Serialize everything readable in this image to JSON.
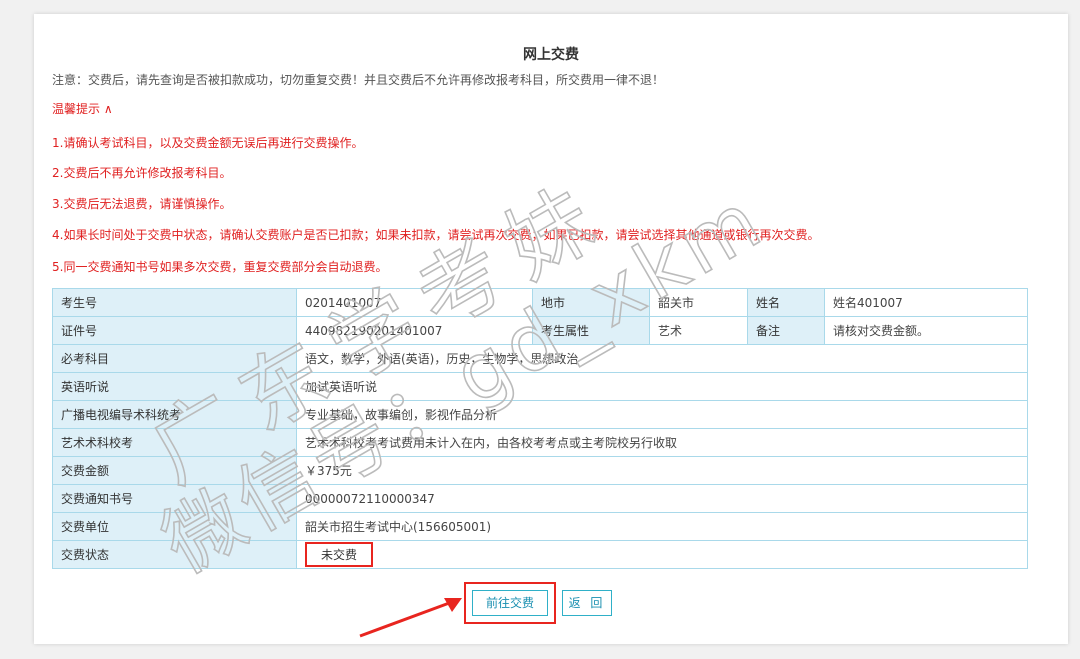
{
  "page": {
    "title": "网上交费",
    "notice": "注意：交费后，请先查询是否被扣款成功，切勿重复交费！并且交费后不允许再修改报考科目，所交费用一律不退！"
  },
  "tips": {
    "toggle_label": "温馨提示 ∧",
    "items": [
      "1.请确认考试科目，以及交费金额无误后再进行交费操作。",
      "2.交费后不再允许修改报考科目。",
      "3.交费后无法退费，请谨慎操作。",
      "4.如果长时间处于交费中状态，请确认交费账户是否已扣款；如果未扣款，请尝试再次交费；如果已扣款，请尝试选择其他通道或银行再次交费。",
      "5.同一交费通知书号如果多次交费，重复交费部分会自动退费。"
    ]
  },
  "info": {
    "exam_no_label": "考生号",
    "exam_no": "0201401007",
    "city_label": "地市",
    "city": "韶关市",
    "name_label": "姓名",
    "name": "姓名401007",
    "id_label": "证件号",
    "id": "440982190201401007",
    "attr_label": "考生属性",
    "attr": "艺术",
    "remark_label": "备注",
    "remark": "请核对交费金额。",
    "required_label": "必考科目",
    "required": "语文，数学，外语(英语)，历史，生物学，思想政治",
    "listening_label": "英语听说",
    "listening": "加试英语听说",
    "broadcast_label": "广播电视编导术科统考",
    "broadcast": "专业基础，故事编创，影视作品分析",
    "art_school_label": "艺术术科校考",
    "art_school": "艺术术科校考考试费用未计入在内，由各校考考点或主考院校另行收取",
    "amount_label": "交费金额",
    "amount": "￥375元",
    "notice_no_label": "交费通知书号",
    "notice_no": "00000072110000347",
    "unit_label": "交费单位",
    "unit": "韶关市招生考试中心(156605001)",
    "status_label": "交费状态",
    "status": "未交费"
  },
  "actions": {
    "pay_label": "前往交费",
    "back_label": "返 回"
  },
  "watermark": {
    "line1": "广东学考妹",
    "line2": "微信号：gd_xkm"
  },
  "colors": {
    "accent": "#e8251f",
    "table_border": "#a9d9ea",
    "label_bg": "#def0f8",
    "button": "#2fb0c8"
  }
}
